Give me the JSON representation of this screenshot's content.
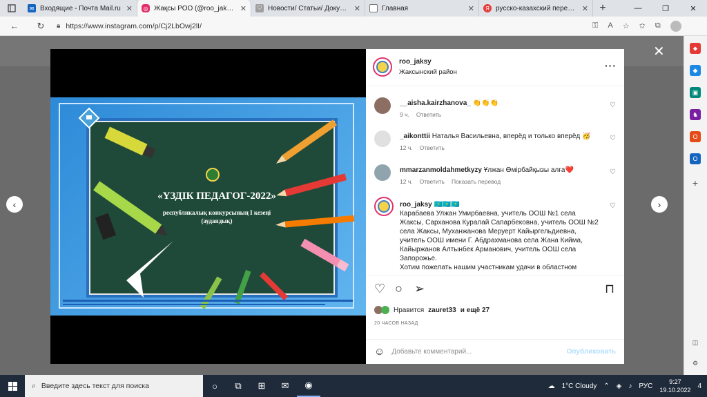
{
  "browser": {
    "tabs": [
      {
        "title": "Входящие - Почта Mail.ru",
        "icon": "mail-icon",
        "color": "#1565c0"
      },
      {
        "title": "Жақсы РОО (@roo_jaksy) • Ф",
        "icon": "instagram-icon",
        "color": "#e1306c",
        "active": true
      },
      {
        "title": "Новости/ Статьи/ Документ",
        "icon": "shield-icon",
        "color": "#888888"
      },
      {
        "title": "Главная",
        "icon": "page-icon",
        "color": "#888888"
      },
      {
        "title": "русско-казахский переводч",
        "icon": "yandex-icon",
        "color": "#e53935"
      }
    ],
    "url": "https://www.instagram.com/p/Cj2LbOwj2lI/"
  },
  "slide": {
    "title": "«ҮЗДІК ПЕДАГОГ-2022»",
    "subtitle_line1": "республикалық конкурсының I кезеңі",
    "subtitle_line2": "(аудандық)"
  },
  "post": {
    "username": "roo_jaksy",
    "location": "Жаксынский район",
    "comments": [
      {
        "user": "__aisha.kairzhanova_",
        "text": "👏👏👏",
        "time": "9 ч.",
        "reply": "Ответить",
        "translate": ""
      },
      {
        "user": "_aikonttii",
        "text": "Наталья Васильевна, вперёд и только вперёд 🥳",
        "time": "12 ч.",
        "reply": "Ответить",
        "translate": ""
      },
      {
        "user": "mmarzanmoldahmetkyzy",
        "text": "Ұлжан Өмірбайқызы алға❤️",
        "time": "12 ч.",
        "reply": "Ответить",
        "translate": "Показать перевод"
      }
    ],
    "caption_user": "roo_jaksy",
    "caption_emoji": "🇰🇿🇰🇿🇰🇿",
    "caption": "Карабаева Улжан Умирбаевна, учитель ООШ №1 села Жаксы, Сарханова Куралай Сапарбековна, учитель ООШ №2 села Жаксы, Муханжанова Меруерт Кайыргельдиевна, учитель ООШ имени Г. Абдрахманова села Жана Кийма, Кайыржанов Алтынбек Арманович, учитель ООШ села Запорожье.",
    "caption2": "Хотим пожелать нашим участникам удачи в областном",
    "likes_prefix": "Нравится",
    "likes_user": "zauret33",
    "likes_suffix": "и ещё 27",
    "posted": "20 ЧАСОВ НАЗАД",
    "add_comment_placeholder": "Добавьте комментарий...",
    "publish": "Опубликовать"
  },
  "taskbar": {
    "search_placeholder": "Введите здесь текст для поиска",
    "weather": "1°C  Cloudy",
    "lang": "РУС",
    "time": "9:27",
    "date": "19.10.2022",
    "notifications": "4"
  }
}
